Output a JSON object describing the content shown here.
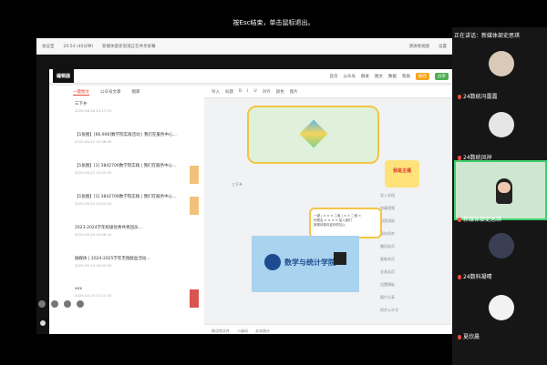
{
  "hint": "按Esc结束，单击鼠标退出。",
  "sharebar": {
    "app": "会议室",
    "info": "20:54 (40分钟)",
    "title": "新媒体部史思琪正在共享屏幕",
    "speaker_btn": "演讲者视图",
    "settings": "设置"
  },
  "editor": {
    "logo": "编辑器",
    "links": [
      "首页",
      "公众号",
      "群发",
      "图文",
      "数据",
      "帮助"
    ],
    "btn_publish": "保存",
    "btn_share": "分享"
  },
  "tabs": [
    "一键图文",
    "公众号文章",
    "图库"
  ],
  "list": [
    {
      "title": "三下乡",
      "date": "2025-06-26 20:17:19"
    },
    {
      "title": "【1张图】[66,906]数学院实践活动 | 我们在服务中心...",
      "date": "2025-06-22 22:38:09"
    },
    {
      "title": "【1张图】[1] 3842706数学院实践 | 我们在服务中心...",
      "date": "2025-06-22 22:45:20"
    },
    {
      "title": "【1张图】[1] 3842706数学院实践 | 我们在服务中心...",
      "date": "2025-06-22 23:41:04"
    },
    {
      "title": "2023-2024学年校级优秀共青团员...",
      "date": "2025-05-20 19:56:24"
    },
    {
      "title": "融媒体 | 2024-2025学年无偿献血活动...",
      "date": "2025-05-19 16:01:59"
    },
    {
      "title": "xxx",
      "date": "2025-05-20 22:11:33"
    }
  ],
  "toolbar": [
    "导入",
    "标题",
    "B",
    "I",
    "U",
    "对齐",
    "颜色",
    "图片"
  ],
  "canvas": {
    "school_name": "数学与统计学院",
    "badge_text": "我是主播",
    "side_label": "三下乡",
    "art2_line1": "一键 | × × × 二维 | × × 二维 ×",
    "art2_line2": "你是否 × × × × 加入我们",
    "art2_line3": "新媒体部欢迎你的加入"
  },
  "rightmenu": [
    "导入文档",
    "加载视频",
    "回到顶部",
    "保存同步",
    "撤回本页",
    "复制本页",
    "全选本页",
    "设置模板",
    "图片分享",
    "同步公众号"
  ],
  "bottombar": [
    "移动到文件",
    "二维码",
    "文本统计"
  ],
  "share_status": "新媒体部史思琪正在共享",
  "speaking": "正在讲话：新媒体部史思琪",
  "participants": [
    {
      "name": "24数统冯露露",
      "avatar_color": "#d8c9b8"
    },
    {
      "name": "24数统凤祥",
      "avatar_color": "#e6e6e6"
    },
    {
      "name": "新媒体部史思琪",
      "avatar_color": "#cfe7d0"
    },
    {
      "name": "24数科凝晴",
      "avatar_color": "#3a3f55"
    },
    {
      "name": "夏欣晨",
      "avatar_color": "#f2f2f2"
    }
  ]
}
